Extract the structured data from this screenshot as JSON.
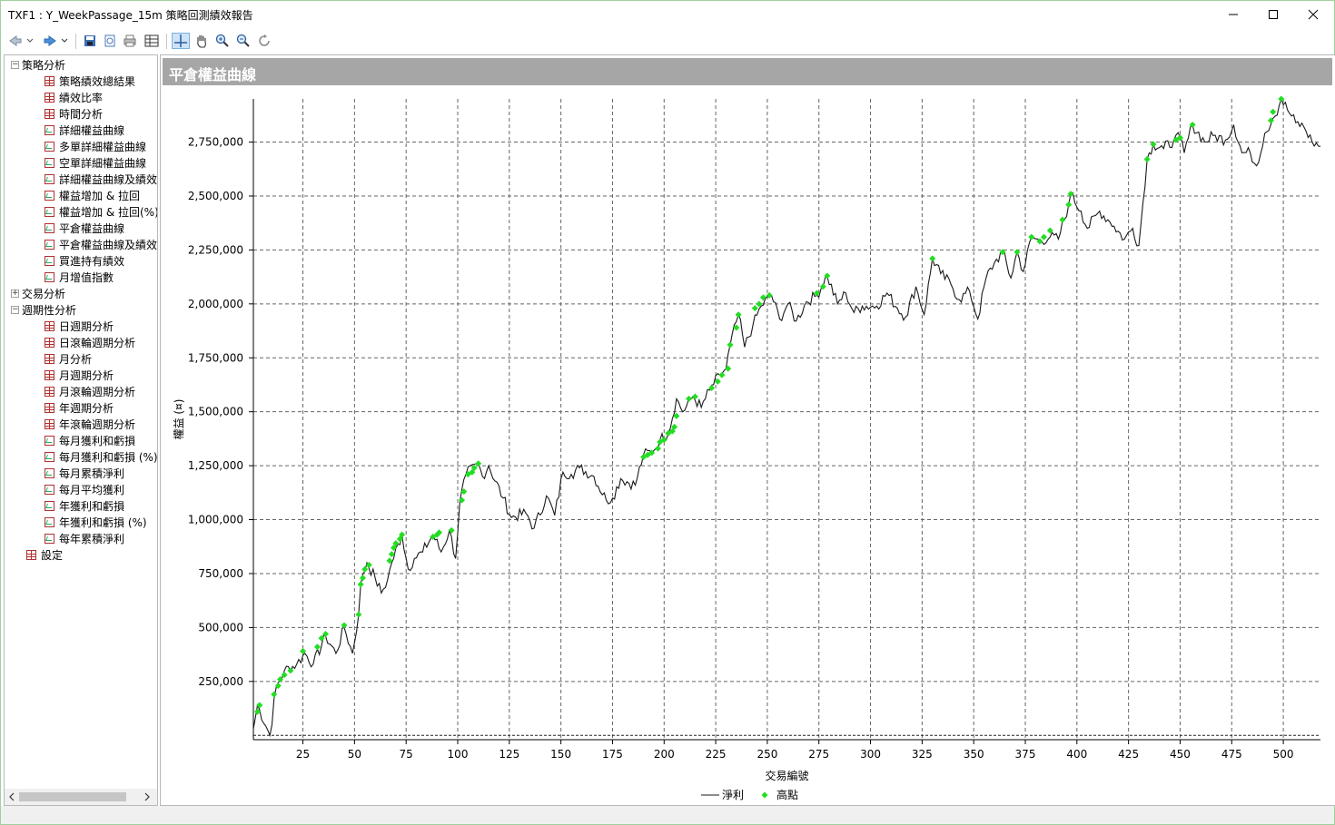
{
  "window": {
    "title": "TXF1 : Y_WeekPassage_15m 策略回測績效報告"
  },
  "toolbar": {
    "buttons": [
      "back-icon",
      "forward-icon",
      "save-icon",
      "preview-icon",
      "print-icon",
      "table-icon",
      "crosshair-icon",
      "pan-hand-icon",
      "zoom-in-icon",
      "zoom-out-icon",
      "reset-zoom-icon"
    ]
  },
  "sidebar": {
    "groups": [
      {
        "label": "策略分析",
        "expanded": true,
        "items": [
          "策略績效總結果",
          "績效比率",
          "時間分析",
          "詳細權益曲線",
          "多單詳細權益曲線",
          "空單詳細權益曲線",
          "詳細權益曲線及績效",
          "權益增加 & 拉回",
          "權益增加 & 拉回(%)",
          "平倉權益曲線",
          "平倉權益曲線及績效",
          "買進持有績效",
          "月增值指數"
        ]
      },
      {
        "label": "交易分析",
        "expanded": false,
        "items": []
      },
      {
        "label": "週期性分析",
        "expanded": true,
        "items": [
          "日週期分析",
          "日滾輪週期分析",
          "月分析",
          "月週期分析",
          "月滾輪週期分析",
          "年週期分析",
          "年滾輪週期分析",
          "每月獲利和虧損",
          "每月獲利和虧損 (%)",
          "每月累積淨利",
          "每月平均獲利",
          "年獲利和虧損",
          "年獲利和虧損 (%)",
          "每年累積淨利"
        ]
      }
    ],
    "settings_label": "設定"
  },
  "panel": {
    "title": "平倉權益曲線"
  },
  "chart_data": {
    "type": "line",
    "xlabel": "交易編號",
    "ylabel": "權益 (¤)",
    "xlim": [
      1,
      518
    ],
    "ylim": [
      -20000,
      2950000
    ],
    "xticks": [
      25,
      50,
      75,
      100,
      125,
      150,
      175,
      200,
      225,
      250,
      275,
      300,
      325,
      350,
      375,
      400,
      425,
      450,
      475,
      500
    ],
    "yticks": [
      250000,
      500000,
      750000,
      1000000,
      1250000,
      1500000,
      1750000,
      2000000,
      2250000,
      2500000,
      2750000
    ],
    "ytick_labels": [
      "250,000",
      "500,000",
      "750,000",
      "1,000,000",
      "1,250,000",
      "1,500,000",
      "1,750,000",
      "2,000,000",
      "2,250,000",
      "2,500,000",
      "2,750,000"
    ],
    "grid": true,
    "legend": [
      "淨利",
      "高點"
    ],
    "legend_position": "bottom",
    "series": [
      {
        "name": "淨利",
        "color": "#1a1a1a",
        "keypoints": [
          [
            1,
            30000
          ],
          [
            3,
            140000
          ],
          [
            9,
            0
          ],
          [
            12,
            220000
          ],
          [
            16,
            300000
          ],
          [
            22,
            330000
          ],
          [
            26,
            380000
          ],
          [
            30,
            330000
          ],
          [
            36,
            460000
          ],
          [
            41,
            380000
          ],
          [
            45,
            500000
          ],
          [
            49,
            380000
          ],
          [
            52,
            560000
          ],
          [
            53,
            700000
          ],
          [
            56,
            800000
          ],
          [
            60,
            730000
          ],
          [
            63,
            660000
          ],
          [
            66,
            720000
          ],
          [
            68,
            800000
          ],
          [
            73,
            930000
          ],
          [
            76,
            770000
          ],
          [
            79,
            820000
          ],
          [
            83,
            850000
          ],
          [
            88,
            930000
          ],
          [
            92,
            850000
          ],
          [
            96,
            950000
          ],
          [
            99,
            820000
          ],
          [
            101,
            1080000
          ],
          [
            104,
            1210000
          ],
          [
            110,
            1260000
          ],
          [
            112,
            1200000
          ],
          [
            115,
            1250000
          ],
          [
            122,
            1100000
          ],
          [
            126,
            1010000
          ],
          [
            133,
            1030000
          ],
          [
            137,
            960000
          ],
          [
            143,
            1110000
          ],
          [
            147,
            1020000
          ],
          [
            151,
            1220000
          ],
          [
            155,
            1210000
          ],
          [
            159,
            1240000
          ],
          [
            166,
            1200000
          ],
          [
            172,
            1090000
          ],
          [
            175,
            1100000
          ],
          [
            179,
            1190000
          ],
          [
            186,
            1160000
          ],
          [
            190,
            1300000
          ],
          [
            195,
            1320000
          ],
          [
            198,
            1370000
          ],
          [
            202,
            1400000
          ],
          [
            206,
            1560000
          ],
          [
            209,
            1500000
          ],
          [
            214,
            1570000
          ],
          [
            218,
            1520000
          ],
          [
            222,
            1600000
          ],
          [
            227,
            1670000
          ],
          [
            230,
            1700000
          ],
          [
            232,
            1810000
          ],
          [
            236,
            1950000
          ],
          [
            239,
            1800000
          ],
          [
            243,
            1900000
          ],
          [
            247,
            1990000
          ],
          [
            252,
            2040000
          ],
          [
            256,
            1930000
          ],
          [
            260,
            2000000
          ],
          [
            264,
            1920000
          ],
          [
            269,
            2010000
          ],
          [
            274,
            2040000
          ],
          [
            279,
            2130000
          ],
          [
            284,
            2000000
          ],
          [
            288,
            2050000
          ],
          [
            292,
            1960000
          ],
          [
            296,
            1990000
          ],
          [
            303,
            1990000
          ],
          [
            308,
            2050000
          ],
          [
            313,
            1980000
          ],
          [
            317,
            1940000
          ],
          [
            322,
            2080000
          ],
          [
            326,
            1950000
          ],
          [
            330,
            2210000
          ],
          [
            334,
            2140000
          ],
          [
            339,
            2090000
          ],
          [
            343,
            2020000
          ],
          [
            348,
            2060000
          ],
          [
            352,
            1930000
          ],
          [
            356,
            2120000
          ],
          [
            360,
            2190000
          ],
          [
            364,
            2240000
          ],
          [
            368,
            2120000
          ],
          [
            371,
            2240000
          ],
          [
            374,
            2150000
          ],
          [
            378,
            2310000
          ],
          [
            382,
            2290000
          ],
          [
            387,
            2310000
          ],
          [
            391,
            2300000
          ],
          [
            396,
            2460000
          ],
          [
            397,
            2510000
          ],
          [
            402,
            2430000
          ],
          [
            405,
            2350000
          ],
          [
            411,
            2430000
          ],
          [
            415,
            2390000
          ],
          [
            418,
            2360000
          ],
          [
            423,
            2300000
          ],
          [
            427,
            2350000
          ],
          [
            430,
            2270000
          ],
          [
            434,
            2670000
          ],
          [
            437,
            2740000
          ],
          [
            442,
            2720000
          ],
          [
            447,
            2760000
          ],
          [
            450,
            2770000
          ],
          [
            452,
            2700000
          ],
          [
            456,
            2830000
          ],
          [
            462,
            2750000
          ],
          [
            466,
            2780000
          ],
          [
            472,
            2760000
          ],
          [
            476,
            2830000
          ],
          [
            480,
            2700000
          ],
          [
            484,
            2700000
          ],
          [
            487,
            2640000
          ],
          [
            491,
            2790000
          ],
          [
            495,
            2860000
          ],
          [
            496,
            2870000
          ],
          [
            499,
            2950000
          ],
          [
            502,
            2900000
          ],
          [
            506,
            2840000
          ],
          [
            510,
            2820000
          ],
          [
            514,
            2750000
          ],
          [
            518,
            2730000
          ]
        ]
      },
      {
        "name": "高點",
        "color": "#22dd22",
        "x": [
          3,
          4,
          11,
          13,
          14,
          16,
          19,
          25,
          32,
          34,
          36,
          45,
          52,
          53,
          54,
          55,
          57,
          67,
          68,
          69,
          70,
          72,
          73,
          88,
          90,
          91,
          97,
          102,
          103,
          105,
          107,
          108,
          110,
          190,
          192,
          194,
          197,
          198,
          200,
          202,
          204,
          205,
          206,
          212,
          215,
          223,
          226,
          228,
          231,
          232,
          235,
          236,
          244,
          246,
          248,
          251,
          274,
          277,
          279,
          330,
          364,
          371,
          378,
          382,
          384,
          387,
          393,
          396,
          397,
          434,
          437,
          448,
          450,
          456,
          494,
          495,
          499
        ],
        "y": [
          110000,
          140000,
          190000,
          230000,
          260000,
          280000,
          300000,
          390000,
          410000,
          450000,
          470000,
          510000,
          560000,
          700000,
          730000,
          770000,
          790000,
          810000,
          840000,
          870000,
          890000,
          910000,
          930000,
          920000,
          930000,
          940000,
          950000,
          1090000,
          1130000,
          1210000,
          1220000,
          1240000,
          1260000,
          1290000,
          1300000,
          1310000,
          1330000,
          1360000,
          1370000,
          1400000,
          1410000,
          1430000,
          1480000,
          1560000,
          1570000,
          1610000,
          1640000,
          1670000,
          1700000,
          1810000,
          1890000,
          1950000,
          1980000,
          2000000,
          2030000,
          2040000,
          2050000,
          2080000,
          2130000,
          2210000,
          2240000,
          2240000,
          2310000,
          2290000,
          2310000,
          2340000,
          2390000,
          2460000,
          2510000,
          2670000,
          2740000,
          2760000,
          2770000,
          2830000,
          2850000,
          2890000,
          2950000
        ]
      }
    ]
  }
}
